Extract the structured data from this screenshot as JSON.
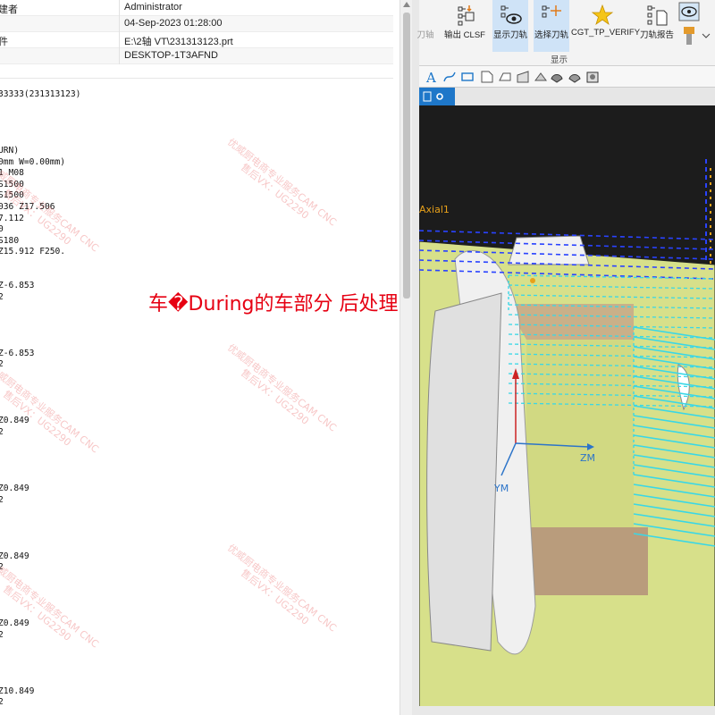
{
  "properties": [
    {
      "key": "建者",
      "value": "Administrator"
    },
    {
      "key": "",
      "value": "04-Sep-2023 01:28:00"
    },
    {
      "key": "件",
      "value": "E:\\2轴 VT\\231313123.prt"
    },
    {
      "key": "",
      "value": "DESKTOP-1T3AFND"
    }
  ],
  "code_lines": [
    {
      "text": "33333(231313123)",
      "line": 0
    },
    {
      "text": "URN)",
      "line": 5
    },
    {
      "text": "0mm W=0.00mm)",
      "line": 6
    },
    {
      "text": "1 M08",
      "line": 7
    },
    {
      "text": "S1500",
      "line": 8
    },
    {
      "text": "S1500",
      "line": 9
    },
    {
      "text": "036 Z17.506",
      "line": 10
    },
    {
      "text": "7.112",
      "line": 11
    },
    {
      "text": "0",
      "line": 12
    },
    {
      "text": "S180",
      "line": 13
    },
    {
      "text": "Z15.912 F250.",
      "line": 14
    },
    {
      "text": "Z-6.853",
      "line": 17
    },
    {
      "text": "2",
      "line": 18
    },
    {
      "text": "Z-6.853",
      "line": 23
    },
    {
      "text": "2",
      "line": 24
    },
    {
      "text": "Z0.849",
      "line": 29
    },
    {
      "text": "2",
      "line": 30
    },
    {
      "text": "Z0.849",
      "line": 35
    },
    {
      "text": "2",
      "line": 36
    },
    {
      "text": "Z0.849",
      "line": 41
    },
    {
      "text": "2",
      "line": 42
    },
    {
      "text": "Z0.849",
      "line": 47
    },
    {
      "text": "2",
      "line": 48
    },
    {
      "text": "Z10.849",
      "line": 53
    },
    {
      "text": "2",
      "line": 54
    }
  ],
  "annotation": "车�During的车部分 后处理",
  "watermark": {
    "line1": "优威厨电商专业服务CAM CNC",
    "line2": "售后VX：UG2290"
  },
  "ribbon": {
    "buttons": [
      {
        "label": "刀轴",
        "icon": "tool-axis-icon"
      },
      {
        "label": "输出 CLSF",
        "icon": "output-clsf-icon"
      },
      {
        "label": "显示刀轨",
        "icon": "display-toolpath-icon",
        "selected": true
      },
      {
        "label": "选择刀轨",
        "icon": "select-toolpath-icon",
        "selected": true
      },
      {
        "label": "CGT_TP_VERIFY",
        "icon": "star-icon"
      },
      {
        "label": "刀轨报告",
        "icon": "toolpath-report-icon"
      }
    ],
    "group_label": "显示"
  },
  "viewport": {
    "axis_labels": {
      "zm": "ZM",
      "ym": "YM"
    },
    "axial_label": "Axial1",
    "colors": {
      "background": "#1c1c1c",
      "part": "#d7e08a",
      "toolpath": "#39d7e6",
      "rapid": "#2a43ff"
    }
  }
}
